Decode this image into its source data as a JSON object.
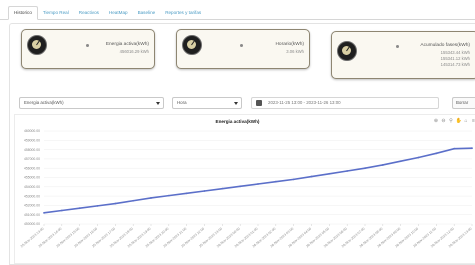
{
  "tabs": [
    {
      "label": "Historico",
      "active": true
    },
    {
      "label": "Tiempo Real",
      "active": false
    },
    {
      "label": "Reactivos",
      "active": false
    },
    {
      "label": "HeatMap",
      "active": false
    },
    {
      "label": "Baseline",
      "active": false
    },
    {
      "label": "Reportes y tarifas",
      "active": false
    }
  ],
  "cards": [
    {
      "title": "Energia activa(kWh)",
      "values": [
        "456016.29 kWh"
      ]
    },
    {
      "title": "Horario(kWh)",
      "values": [
        "3.06 kWh"
      ]
    },
    {
      "title": "Acumulado fases(kWh)",
      "values": [
        "155343.44 kWh",
        "155341.12 kWh",
        "145314.73 kWh"
      ]
    }
  ],
  "controls": {
    "variable_select": "Energia activa(kWh)",
    "interval_select": "Hora",
    "date_range": "2023-11-25 13:00 - 2023-11-26 13:00",
    "clear_button": "Borrar"
  },
  "chart_data": {
    "type": "line",
    "title": "Energia activa(kWh)",
    "ylim": [
      450000,
      460000
    ],
    "yticks": [
      "460000.00",
      "459000.00",
      "458000.00",
      "457000.00",
      "456000.00",
      "455000.00",
      "454000.00",
      "453000.00",
      "452000.00",
      "451000.00",
      "450000.00"
    ],
    "x": [
      "25-Nov-2023 13:00",
      "25-Nov-2023 14:00",
      "25-Nov-2023 15:00",
      "25-Nov-2023 16:00",
      "25-Nov-2023 17:00",
      "25-Nov-2023 18:00",
      "25-Nov-2023 19:00",
      "25-Nov-2023 20:00",
      "25-Nov-2023 21:00",
      "25-Nov-2023 22:00",
      "25-Nov-2023 23:00",
      "26-Nov-2023 00:00",
      "26-Nov-2023 01:00",
      "26-Nov-2023 02:00",
      "26-Nov-2023 03:00",
      "26-Nov-2023 04:00",
      "26-Nov-2023 05:00",
      "26-Nov-2023 06:00",
      "26-Nov-2023 07:00",
      "26-Nov-2023 08:00",
      "26-Nov-2023 09:00",
      "26-Nov-2023 10:00",
      "26-Nov-2023 11:00",
      "26-Nov-2023 12:00",
      "26-Nov-2023 13:00"
    ],
    "series": [
      {
        "values": [
          451200,
          451450,
          451700,
          451950,
          452200,
          452500,
          452800,
          453050,
          453300,
          453550,
          453800,
          454050,
          454300,
          454550,
          454800,
          455100,
          455400,
          455700,
          456000,
          456350,
          456750,
          457150,
          457600,
          458100,
          458150
        ],
        "color": "#5b6fc9"
      }
    ],
    "grid": true
  }
}
